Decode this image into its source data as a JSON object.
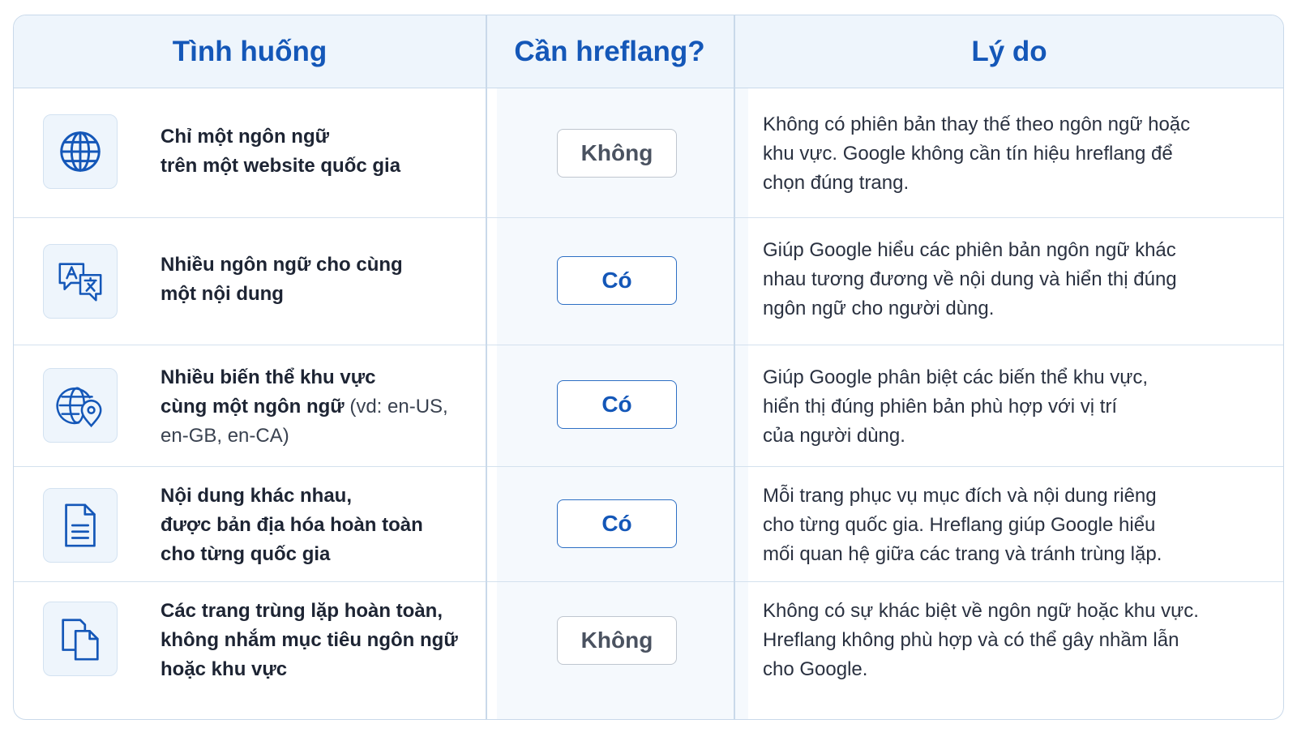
{
  "columns": {
    "situation": "Tình huống",
    "need_hreflang": "Cần hreflang?",
    "reason": "Lý do"
  },
  "rows": [
    {
      "icon": "globe-icon",
      "situation_line1": "Chỉ một ngôn ngữ",
      "situation_line2": "trên một website quốc gia",
      "answer": "Không",
      "reason_line1": "Không có phiên bản thay thế theo ngôn ngữ hoặc",
      "reason_line2": "khu vực. Google không cần tín hiệu hreflang để",
      "reason_line3": "chọn đúng trang."
    },
    {
      "icon": "translate-icon",
      "situation_line1": "Nhiều ngôn ngữ cho cùng",
      "situation_line2": "một nội dung",
      "answer": "Có",
      "reason_line1": "Giúp Google hiểu các phiên bản ngôn ngữ khác",
      "reason_line2": "nhau tương đương về nội dung và hiển thị đúng",
      "reason_line3": "ngôn ngữ cho người dùng."
    },
    {
      "icon": "globe-location-icon",
      "situation_line1": "Nhiều biến thể khu vực",
      "situation_line2": "cùng một ngôn ngữ",
      "situation_note": " (vd: en-US,",
      "situation_line3": "en-GB, en-CA)",
      "answer": "Có",
      "reason_line1": "Giúp Google phân biệt các biến thể khu vực,",
      "reason_line2": "hiển thị đúng phiên bản phù hợp với vị trí",
      "reason_line3": "của người dùng."
    },
    {
      "icon": "document-icon",
      "situation_line1": "Nội dung khác nhau,",
      "situation_line2": "được bản địa hóa hoàn toàn",
      "situation_line3": "cho từng quốc gia",
      "answer": "Có",
      "reason_line1": "Mỗi trang phục vụ mục đích và nội dung riêng",
      "reason_line2": "cho từng quốc gia. Hreflang giúp Google hiểu",
      "reason_line3": "mối quan hệ giữa các trang và tránh trùng lặp."
    },
    {
      "icon": "copy-icon",
      "situation_line1": "Các trang trùng lặp hoàn toàn,",
      "situation_line2": "không nhắm mục tiêu ngôn ngữ",
      "situation_line3": "hoặc khu vực",
      "answer": "Không",
      "reason_line1": "Không có sự khác biệt về ngôn ngữ hoặc khu vực.",
      "reason_line2": "Hreflang không phù hợp và có thể gây nhầm lẫn",
      "reason_line3": "cho Google."
    }
  ],
  "colors": {
    "accent": "#1457b8",
    "header_bg": "#eef5fc",
    "border": "#c9d9ea"
  }
}
